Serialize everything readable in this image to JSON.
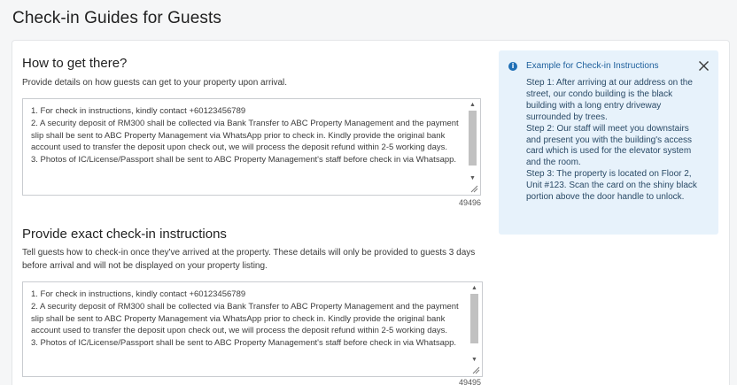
{
  "page": {
    "title": "Check-in Guides for Guests"
  },
  "section1": {
    "title": "How to get there?",
    "description": "Provide details on how guests can get to your property upon arrival.",
    "textarea_value": "1. For check in instructions, kindly contact +60123456789\n2. A security deposit of RM300 shall be collected via Bank Transfer to ABC Property Management and the payment slip shall be sent to ABC Property Management via WhatsApp prior to check in. Kindly provide the original bank account used to transfer the deposit upon check out, we will process the deposit refund within 2-5 working days.\n3. Photos of IC/License/Passport shall be sent to ABC Property Management's staff before check in via Whatsapp.",
    "char_count": "49496"
  },
  "section2": {
    "title": "Provide exact check-in instructions",
    "description": "Tell guests how to check-in once they've arrived at the property. These details will only be provided to guests 3 days before arrival and will not be displayed on your property listing.",
    "textarea_value": "1. For check in instructions, kindly contact +60123456789\n2. A security deposit of RM300 shall be collected via Bank Transfer to ABC Property Management and the payment slip shall be sent to ABC Property Management via WhatsApp prior to check in. Kindly provide the original bank account used to transfer the deposit upon check out, we will process the deposit refund within 2-5 working days.\n3. Photos of IC/License/Passport shall be sent to ABC Property Management's staff before check in via Whatsapp.",
    "char_count": "49495"
  },
  "info_box": {
    "title": "Example for Check-in Instructions",
    "icon": "info-icon",
    "body": "Step 1: After arriving at our address on the street, our condo building is the black building with a long entry driveway surrounded by trees.\nStep 2: Our staff will meet you downstairs and present you with the building's access card which is used for the elevator system and the room.\nStep 3: The property is located on Floor 2, Unit #123. Scan the card on the shiny black portion above the door handle to unlock."
  },
  "colors": {
    "accent": "#1f6fb5",
    "info_bg": "#e7f2fb"
  }
}
